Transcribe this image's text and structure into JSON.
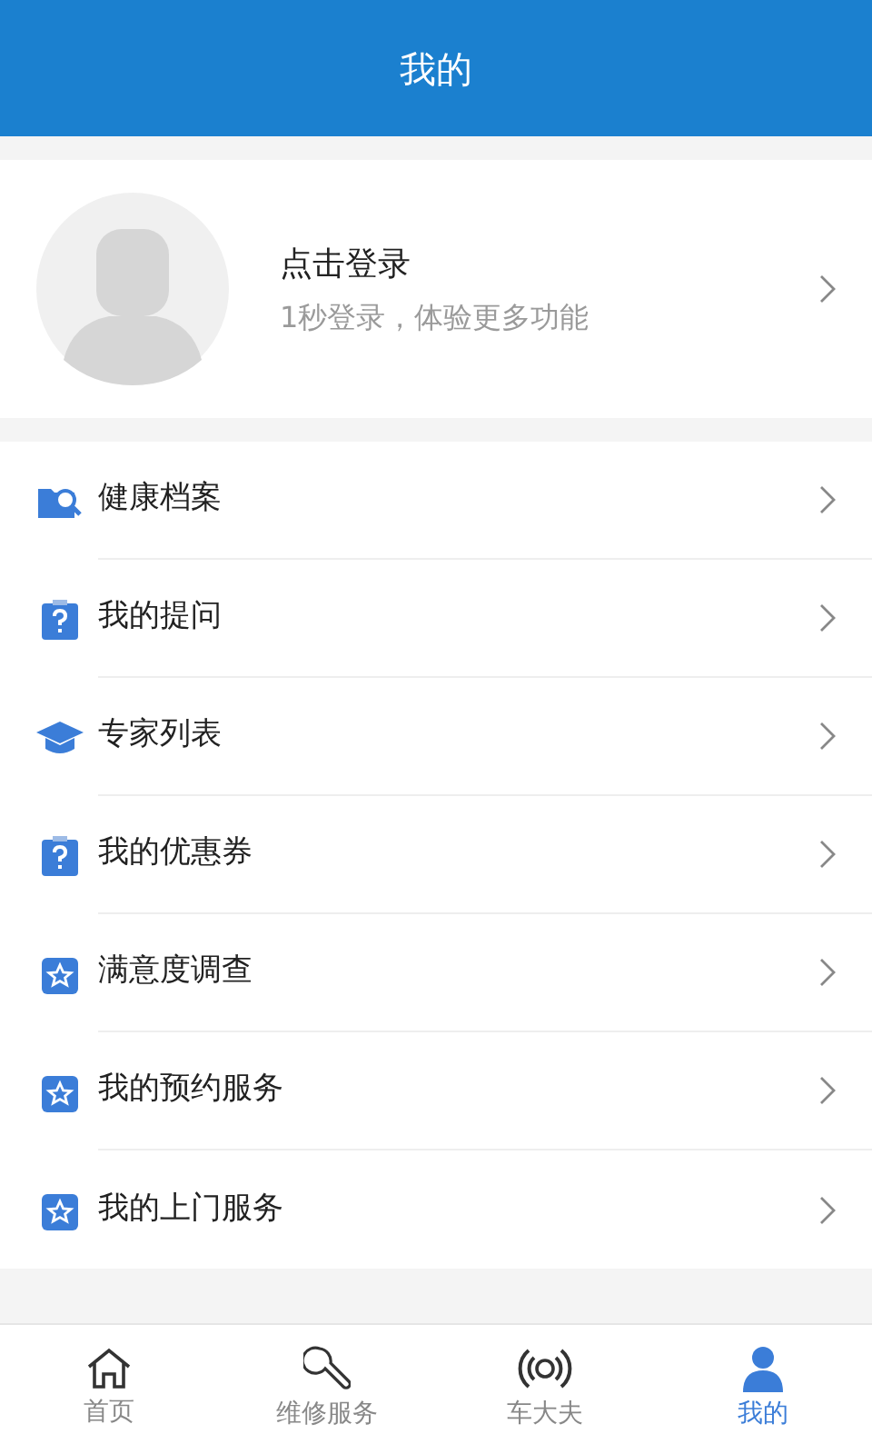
{
  "header": {
    "title": "我的"
  },
  "profile": {
    "name": "点击登录",
    "subtitle": "1秒登录，体验更多功能"
  },
  "menu": [
    {
      "kind": "records",
      "label": "健康档案"
    },
    {
      "kind": "question",
      "label": "我的提问"
    },
    {
      "kind": "expert",
      "label": "专家列表"
    },
    {
      "kind": "question",
      "label": "我的优惠券"
    },
    {
      "kind": "star",
      "label": "满意度调查"
    },
    {
      "kind": "star",
      "label": "我的预约服务"
    },
    {
      "kind": "star",
      "label": "我的上门服务"
    }
  ],
  "tabs": [
    {
      "kind": "home",
      "label": "首页",
      "selected": false
    },
    {
      "kind": "wrench",
      "label": "维修服务",
      "selected": false
    },
    {
      "kind": "signal",
      "label": "车大夫",
      "selected": false
    },
    {
      "kind": "person",
      "label": "我的",
      "selected": true
    }
  ]
}
